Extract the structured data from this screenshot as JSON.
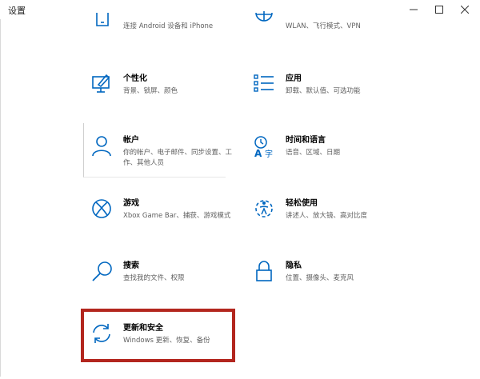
{
  "window": {
    "title": "设置",
    "controls": [
      "minimize",
      "maximize",
      "close"
    ]
  },
  "partial_row": {
    "left_desc": "连接 Android 设备和 iPhone",
    "right_desc": "WLAN、飞行模式、VPN"
  },
  "tiles": [
    {
      "title": "个性化",
      "desc": "背景、锁屏、颜色",
      "icon": "personalization-icon"
    },
    {
      "title": "应用",
      "desc": "卸载、默认值、可选功能",
      "icon": "apps-icon"
    },
    {
      "title": "帐户",
      "desc": "你的帐户、电子邮件、同步设置、工作、其他人员",
      "icon": "account-icon"
    },
    {
      "title": "时间和语言",
      "desc": "语音、区域、日期",
      "icon": "time-language-icon"
    },
    {
      "title": "游戏",
      "desc": "Xbox Game Bar、捕获、游戏模式",
      "icon": "xbox-icon"
    },
    {
      "title": "轻松使用",
      "desc": "讲述人、放大镜、高对比度",
      "icon": "ease-of-access-icon"
    },
    {
      "title": "搜索",
      "desc": "查找我的文件、权限",
      "icon": "search-icon"
    },
    {
      "title": "隐私",
      "desc": "位置、摄像头、麦克风",
      "icon": "lock-icon"
    },
    {
      "title": "更新和安全",
      "desc": "Windows 更新、恢复、备份",
      "icon": "update-icon"
    }
  ],
  "colors": {
    "accent": "#0067c0",
    "highlight": "#b3261e"
  }
}
